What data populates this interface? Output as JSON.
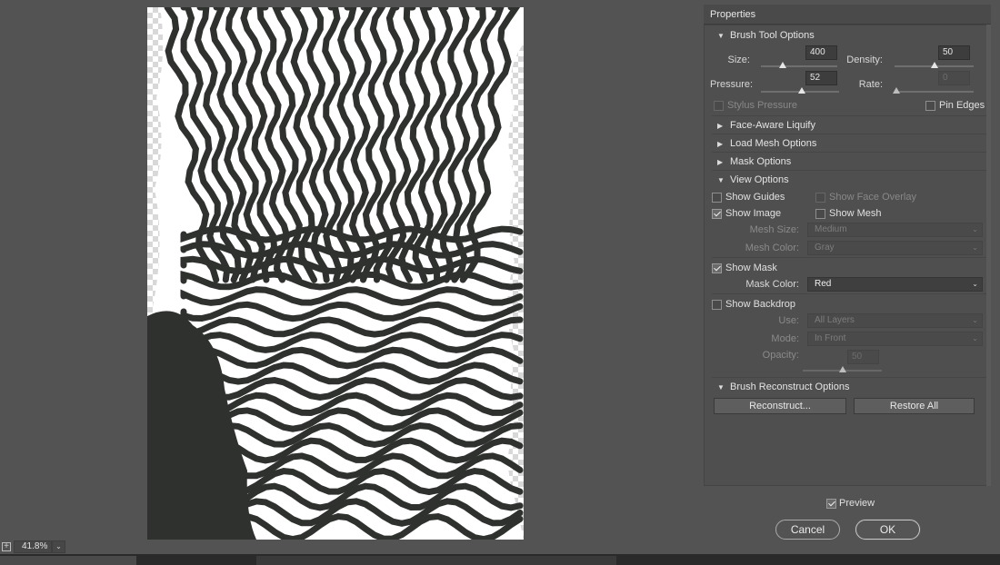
{
  "canvas": {
    "zoom_value": "41.8%",
    "zoom_plus": "+",
    "dropdown": "⌄"
  },
  "panel": {
    "title": "Properties",
    "brush_tool_options": {
      "heading": "Brush Tool Options",
      "size_label": "Size:",
      "size_value": "400",
      "size_level": 0.28,
      "density_label": "Density:",
      "density_value": "50",
      "density_level": 0.5,
      "pressure_label": "Pressure:",
      "pressure_value": "52",
      "pressure_level": 0.52,
      "rate_label": "Rate:",
      "rate_value": "0",
      "rate_level": 0.0,
      "stylus_pressure": "Stylus Pressure",
      "pin_edges": "Pin Edges"
    },
    "face_aware": "Face-Aware Liquify",
    "load_mesh": "Load Mesh Options",
    "mask_options": "Mask Options",
    "view_options": {
      "heading": "View Options",
      "show_guides": "Show Guides",
      "show_face_overlay": "Show Face Overlay",
      "show_image": "Show Image",
      "show_mesh": "Show Mesh",
      "mesh_size_label": "Mesh Size:",
      "mesh_size_value": "Medium",
      "mesh_color_label": "Mesh Color:",
      "mesh_color_value": "Gray",
      "show_mask": "Show Mask",
      "mask_color_label": "Mask Color:",
      "mask_color_value": "Red",
      "show_backdrop": "Show Backdrop",
      "use_label": "Use:",
      "use_value": "All Layers",
      "mode_label": "Mode:",
      "mode_value": "In Front",
      "opacity_label": "Opacity:",
      "opacity_value": "50",
      "opacity_level": 0.5
    },
    "brush_reconstruct": {
      "heading": "Brush Reconstruct Options",
      "reconstruct_btn": "Reconstruct...",
      "restore_btn": "Restore All"
    }
  },
  "dialog": {
    "preview": "Preview",
    "cancel": "Cancel",
    "ok": "OK"
  },
  "glyphs": {
    "tri_down": "▼",
    "tri_right": "▶",
    "chevron": "⌄"
  },
  "colors": {
    "panel_bg": "#535353",
    "stripes": "#2f312f",
    "paper": "#ffffff"
  }
}
